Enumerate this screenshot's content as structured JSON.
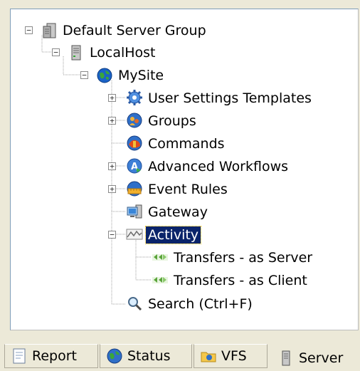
{
  "tree": {
    "nodes": [
      {
        "label": "Default Server Group",
        "icon": "server-group-icon",
        "expander": "−"
      },
      {
        "label": "LocalHost",
        "icon": "server-icon",
        "expander": "−"
      },
      {
        "label": "MySite",
        "icon": "globe-icon",
        "expander": "−"
      },
      {
        "label": "User Settings Templates",
        "icon": "gear-icon",
        "expander": "+"
      },
      {
        "label": "Groups",
        "icon": "groups-icon",
        "expander": "+"
      },
      {
        "label": "Commands",
        "icon": "commands-icon",
        "expander": ""
      },
      {
        "label": "Advanced Workflows",
        "icon": "workflow-icon",
        "expander": "+"
      },
      {
        "label": "Event Rules",
        "icon": "event-rules-icon",
        "expander": "+"
      },
      {
        "label": "Gateway",
        "icon": "gateway-icon",
        "expander": ""
      },
      {
        "label": "Activity",
        "icon": "activity-icon",
        "expander": "−",
        "selected": true
      },
      {
        "label": "Transfers - as Server",
        "icon": "transfers-icon",
        "expander": ""
      },
      {
        "label": "Transfers - as Client",
        "icon": "transfers-icon",
        "expander": ""
      },
      {
        "label": "Search (Ctrl+F)",
        "icon": "search-icon",
        "expander": ""
      }
    ]
  },
  "tabs": [
    {
      "label": "Report",
      "icon": "report-icon"
    },
    {
      "label": "Status",
      "icon": "status-icon"
    },
    {
      "label": "VFS",
      "icon": "folder-icon"
    },
    {
      "label": "Server",
      "icon": "server-icon",
      "active": true
    }
  ]
}
